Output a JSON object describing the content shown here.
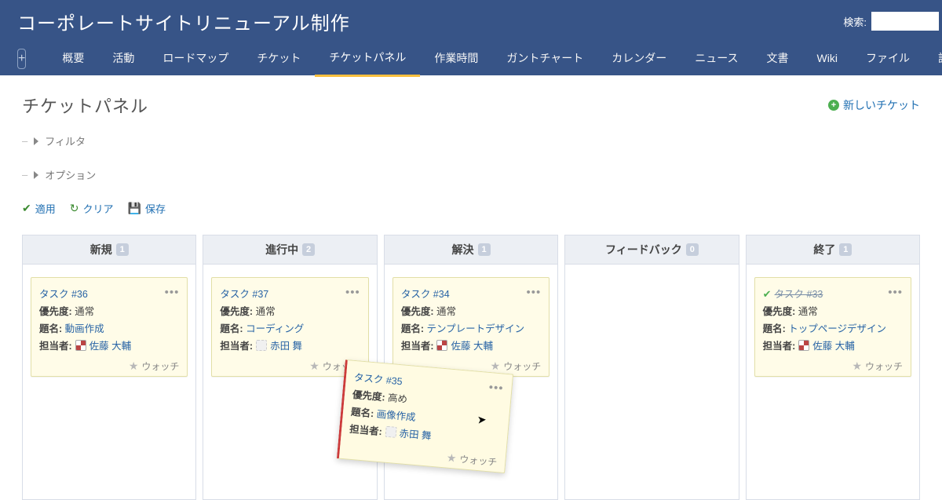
{
  "header": {
    "project_title": "コーポレートサイトリニューアル制作",
    "search_label": "検索:",
    "search_placeholder": ""
  },
  "nav": {
    "items": [
      "概要",
      "活動",
      "ロードマップ",
      "チケット",
      "チケットパネル",
      "作業時間",
      "ガントチャート",
      "カレンダー",
      "ニュース",
      "文書",
      "Wiki",
      "ファイル",
      "設定"
    ],
    "active_index": 4
  },
  "page": {
    "title": "チケットパネル",
    "new_ticket_label": "新しいチケット",
    "filter_label": "フィルタ",
    "options_label": "オプション",
    "apply_label": "適用",
    "clear_label": "クリア",
    "save_label": "保存"
  },
  "labels": {
    "priority": "優先度:",
    "subject": "題名:",
    "assignee": "担当者:",
    "watch": "ウォッチ"
  },
  "board": {
    "columns": [
      {
        "name": "新規",
        "count": 1
      },
      {
        "name": "進行中",
        "count": 2
      },
      {
        "name": "解決",
        "count": 1
      },
      {
        "name": "フィードバック",
        "count": 0
      },
      {
        "name": "終了",
        "count": 1
      }
    ]
  },
  "cards": {
    "c36": {
      "ticket": "タスク #36",
      "priority": "通常",
      "subject": "動画作成",
      "assignee": "佐藤 大輔",
      "avatar": "pattern"
    },
    "c37": {
      "ticket": "タスク #37",
      "priority": "通常",
      "subject": "コーディング",
      "assignee": "赤田 舞",
      "avatar": "blank"
    },
    "c35": {
      "ticket": "タスク #35",
      "priority": "高め",
      "subject": "画像作成",
      "assignee": "赤田 舞",
      "avatar": "blank"
    },
    "c34": {
      "ticket": "タスク #34",
      "priority": "通常",
      "subject": "テンプレートデザイン",
      "assignee": "佐藤 大輔",
      "avatar": "pattern"
    },
    "c33": {
      "ticket": "タスク #33",
      "priority": "通常",
      "subject": "トップページデザイン",
      "assignee": "佐藤 大輔",
      "avatar": "pattern",
      "done": true
    }
  }
}
